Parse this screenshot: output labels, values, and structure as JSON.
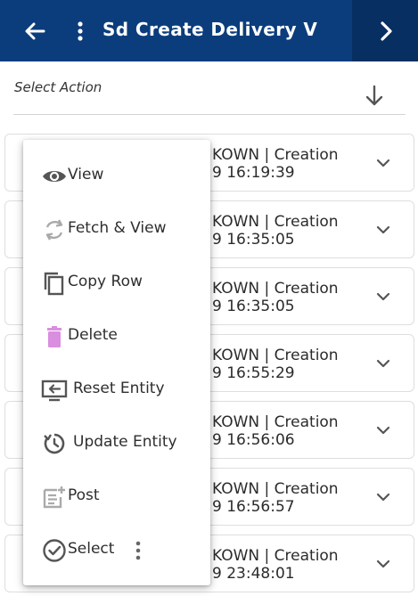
{
  "header": {
    "title": "Sd Create Delivery V",
    "back_icon": "arrow-left-icon",
    "menu_icon": "kebab-vertical-icon",
    "next_icon": "chevron-right-icon",
    "bg_color": "#0b3d7c",
    "next_bg_color": "#082f62"
  },
  "toolbar": {
    "select_action_label": "Select Action",
    "sort_icon": "arrow-down-icon"
  },
  "rows": [
    {
      "line1": "KOWN | Creation",
      "line2": "9 16:19:39"
    },
    {
      "line1": "KOWN | Creation",
      "line2": "9 16:35:05"
    },
    {
      "line1": "KOWN | Creation",
      "line2": "9 16:35:05"
    },
    {
      "line1": "KOWN | Creation",
      "line2": "9 16:55:29"
    },
    {
      "line1": "KOWN | Creation",
      "line2": "9 16:56:06"
    },
    {
      "line1": "KOWN | Creation",
      "line2": "9 16:56:57"
    },
    {
      "line1": "KOWN | Creation",
      "line2": "9 23:48:01"
    }
  ],
  "context_menu": {
    "items": [
      {
        "label": "View",
        "icon": "eye-icon"
      },
      {
        "label": "Fetch & View",
        "icon": "refresh-icon"
      },
      {
        "label": "Copy Row",
        "icon": "copy-icon"
      },
      {
        "label": "Delete",
        "icon": "trash-icon",
        "color": "#d98ee0"
      },
      {
        "label": "Reset Entity",
        "icon": "reset-entity-icon"
      },
      {
        "label": "Update Entity",
        "icon": "update-clock-icon"
      },
      {
        "label": "Post",
        "icon": "post-note-icon"
      },
      {
        "label": "Select",
        "icon": "check-circle-icon"
      }
    ]
  }
}
